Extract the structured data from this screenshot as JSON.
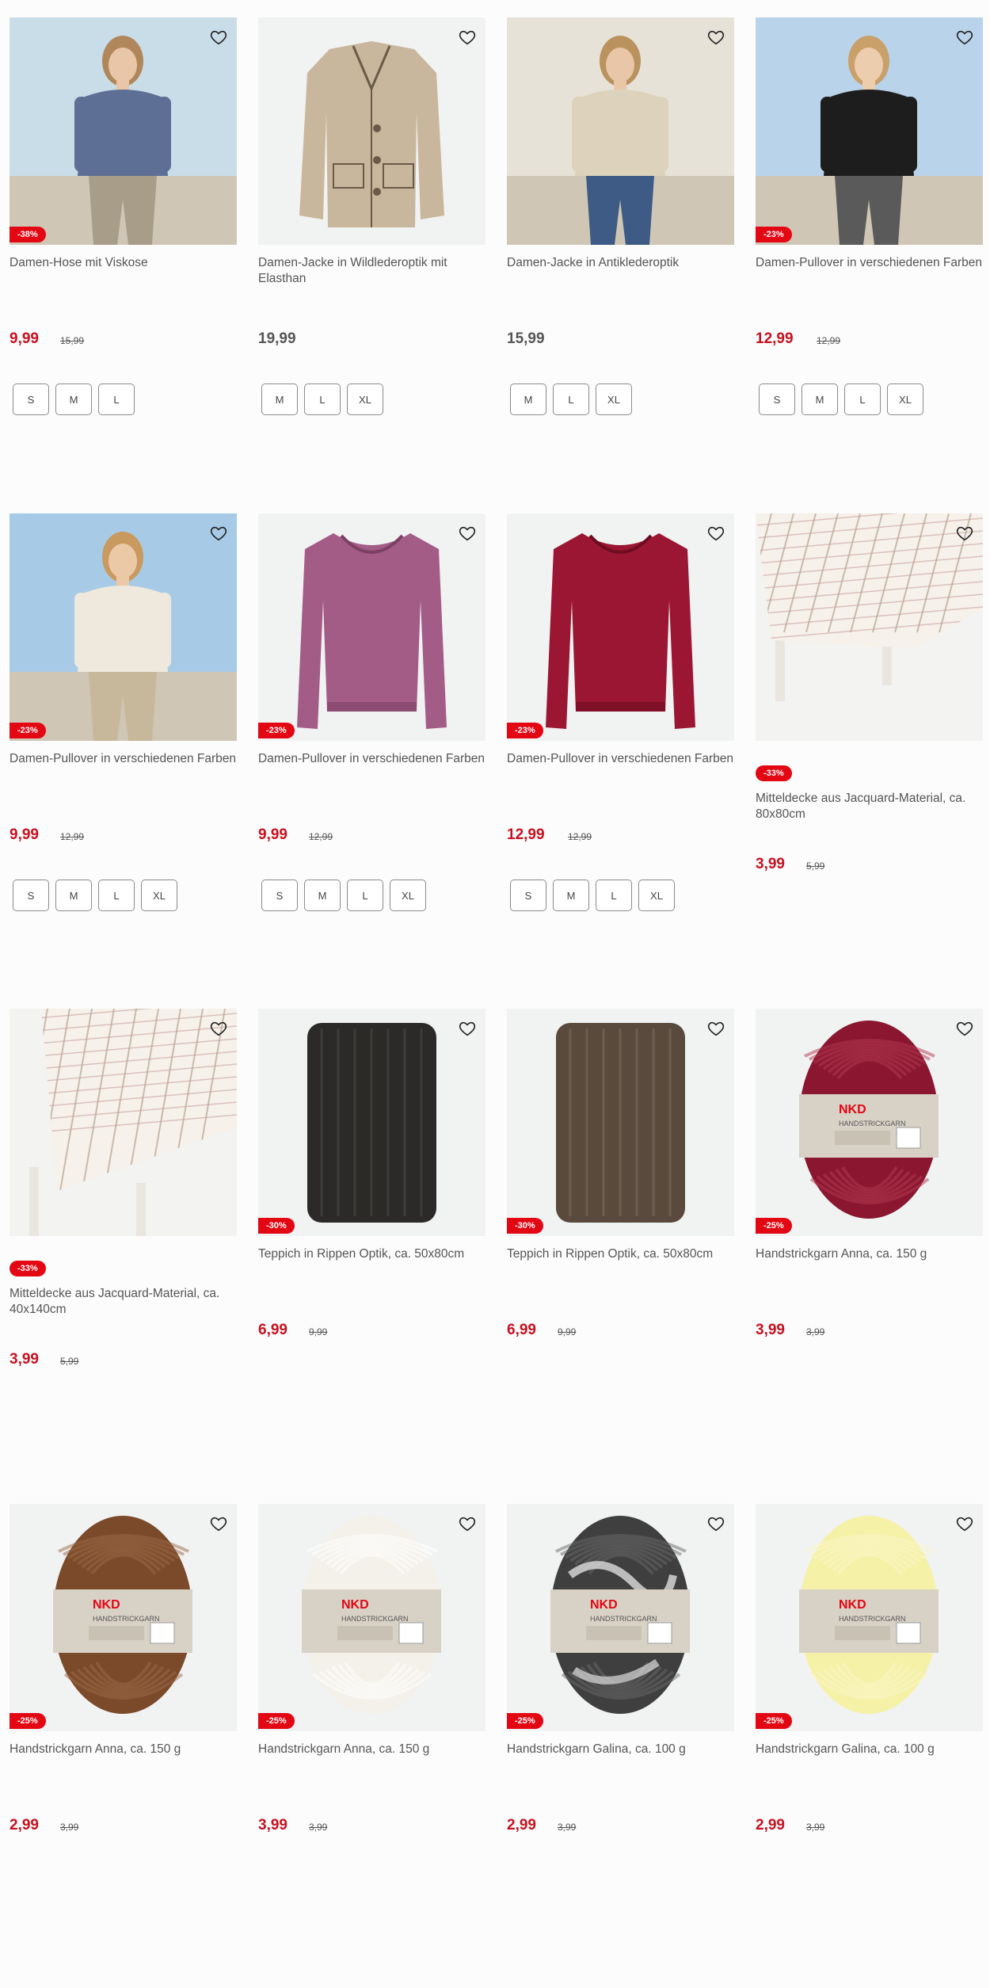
{
  "products": [
    {
      "title": "Damen-Hose mit Viskose",
      "price": "9,99",
      "old": "15,99",
      "badge": "-38%",
      "sizes": [
        "S",
        "M",
        "L"
      ],
      "heart_icon": "heart-outline-icon"
    },
    {
      "title": "Damen-Jacke in Wildlederoptik mit Elasthan",
      "price": "19,99",
      "old": "",
      "badge": "",
      "sizes": [
        "M",
        "L",
        "XL"
      ]
    },
    {
      "title": "Damen-Jacke in Antiklederoptik",
      "price": "15,99",
      "old": "",
      "badge": "",
      "sizes": [
        "M",
        "L",
        "XL"
      ]
    },
    {
      "title": "Damen-Pullover in verschiedenen Farben",
      "price": "12,99",
      "old": "12,99",
      "badge": "-23%",
      "sizes": [
        "S",
        "M",
        "L",
        "XL"
      ]
    },
    {
      "title": "Damen-Pullover in verschiedenen Farben",
      "price": "9,99",
      "old": "12,99",
      "badge": "-23%",
      "sizes": [
        "S",
        "M",
        "L",
        "XL"
      ]
    },
    {
      "title": "Damen-Pullover in verschiedenen Farben",
      "price": "9,99",
      "old": "12,99",
      "badge": "-23%",
      "sizes": [
        "S",
        "M",
        "L",
        "XL"
      ]
    },
    {
      "title": "Damen-Pullover in verschiedenen Farben",
      "price": "12,99",
      "old": "12,99",
      "badge": "-23%",
      "sizes": [
        "S",
        "M",
        "L",
        "XL"
      ]
    },
    {
      "title": "Mitteldecke aus Jacquard-Material, ca. 80x80cm",
      "price": "3,99",
      "old": "5,99",
      "badge": "-33%",
      "sizes": []
    },
    {
      "title": "Mitteldecke aus Jacquard-Material, ca. 40x140cm",
      "price": "3,99",
      "old": "5,99",
      "badge": "-33%",
      "sizes": []
    },
    {
      "title": "Teppich in Rippen Optik, ca. 50x80cm",
      "price": "6,99",
      "old": "9,99",
      "badge": "-30%",
      "sizes": []
    },
    {
      "title": "Teppich in Rippen Optik, ca. 50x80cm",
      "price": "6,99",
      "old": "9,99",
      "badge": "-30%",
      "sizes": []
    },
    {
      "title": "Handstrickgarn Anna, ca. 150 g",
      "price": "3,99",
      "old": "3,99",
      "badge": "-25%",
      "sizes": []
    },
    {
      "title": "Handstrickgarn Anna, ca. 150 g",
      "price": "2,99",
      "old": "3,99",
      "badge": "-25%",
      "sizes": []
    },
    {
      "title": "Handstrickgarn Anna, ca. 150 g",
      "price": "3,99",
      "old": "3,99",
      "badge": "-25%",
      "sizes": []
    },
    {
      "title": "Handstrickgarn Galina, ca. 100 g",
      "price": "2,99",
      "old": "3,99",
      "badge": "-25%",
      "sizes": []
    },
    {
      "title": "Handstrickgarn Galina, ca. 100 g",
      "price": "2,99",
      "old": "3,99",
      "badge": "-25%",
      "sizes": []
    }
  ],
  "yarn_brand": "NKD",
  "yarn_label": "HANDSTRICKGARN",
  "colors": {
    "accent": "#e30613",
    "price_sale": "#c7101f",
    "text": "#555555"
  }
}
